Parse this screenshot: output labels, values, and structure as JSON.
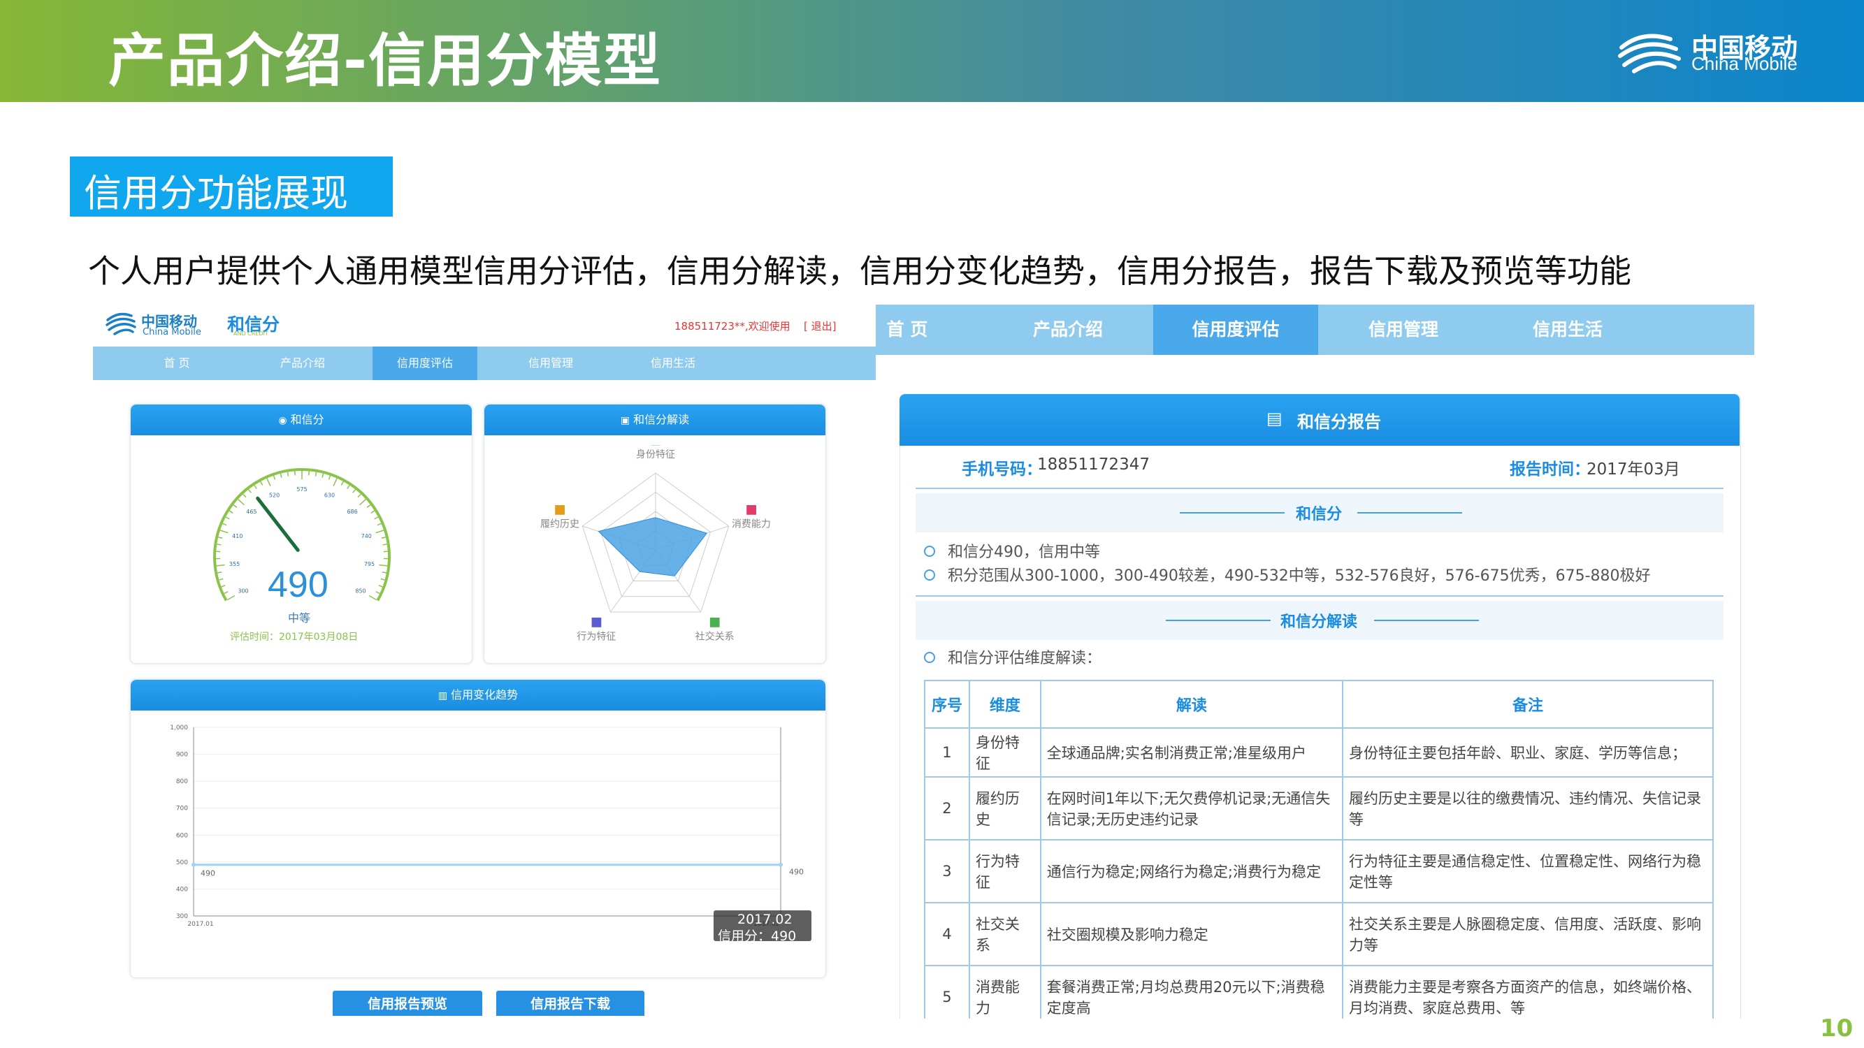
{
  "slide": {
    "title": "产品介绍-信用分模型",
    "brand_cn": "中国移动",
    "brand_en": "China Mobile",
    "section_title": "信用分功能展现",
    "description": "个人用户提供个人通用模型信用分评估，信用分解读，信用分变化趋势，信用分报告，报告下载及预览等功能",
    "page_number": "10"
  },
  "left_app": {
    "logo_cn": "中国移动",
    "logo_en": "China Mobile",
    "product_logo": "和信分",
    "product_logo_en": "AND CREDIT",
    "user_greeting": "188511723**,欢迎使用",
    "logout": "[ 退出]",
    "nav": [
      "首 页",
      "产品介绍",
      "信用度评估",
      "信用管理",
      "信用生活"
    ],
    "nav_active_index": 2,
    "score_panel": {
      "title": "和信分",
      "score": "490",
      "level": "中等",
      "eval_time": "评估时间：2017年03月08日",
      "gauge_ticks": [
        "300",
        "355",
        "410",
        "465",
        "520",
        "575",
        "630",
        "686",
        "740",
        "795",
        "850"
      ],
      "gauge_min": 300,
      "gauge_max": 850,
      "needle_value": 490
    },
    "radar_panel": {
      "title": "和信分解读",
      "axes": [
        "身份特征",
        "消费能力",
        "社交关系",
        "行为特征",
        "履约历史"
      ],
      "values": [
        0.42,
        0.7,
        0.42,
        0.35,
        0.78
      ]
    },
    "trend_panel": {
      "title": "信用变化趋势",
      "tooltip_date": "2017.02",
      "tooltip_value": "信用分：490"
    },
    "buttons": [
      "信用报告预览",
      "信用报告下载"
    ]
  },
  "chart_data": {
    "type": "line",
    "title": "信用变化趋势",
    "x": [
      "2017.01",
      "2017.02"
    ],
    "series": [
      {
        "values": [
          490,
          490
        ]
      }
    ],
    "yticks": [
      300,
      400,
      500,
      600,
      700,
      800,
      900,
      1000
    ],
    "ytick_labels": [
      "300",
      "400",
      "500",
      "600",
      "700",
      "800",
      "900",
      "1,000"
    ],
    "ylim": [
      300,
      1000
    ],
    "point_labels": [
      "490",
      "490"
    ],
    "grid": true
  },
  "right_app": {
    "nav": [
      "首 页",
      "产品介绍",
      "信用度评估",
      "信用管理",
      "信用生活"
    ],
    "nav_active_index": 2,
    "report_title": "和信分报告",
    "phone_label": "手机号码：",
    "phone_value": "18851172347",
    "time_label": "报告时间：",
    "time_value": "2017年03月",
    "score_section": "和信分",
    "score_lines": [
      "和信分490，信用中等",
      "积分范围从300-1000，300-490较差，490-532中等，532-576良好，576-675优秀，675-880极好"
    ],
    "reading_section": "和信分解读",
    "reading_intro": "和信分评估维度解读：",
    "table": {
      "headers": [
        "序号",
        "维度",
        "解读",
        "备注"
      ],
      "rows": [
        [
          "1",
          "身份特征",
          "全球通品牌;实名制消费正常;准星级用户",
          "身份特征主要包括年龄、职业、家庭、学历等信息；"
        ],
        [
          "2",
          "履约历史",
          "在网时间1年以下;无欠费停机记录;无通信失信记录;无历史违约记录",
          "履约历史主要是以往的缴费情况、违约情况、失信记录等"
        ],
        [
          "3",
          "行为特征",
          "通信行为稳定;网络行为稳定;消费行为稳定",
          "行为特征主要是通信稳定性、位置稳定性、网络行为稳定性等"
        ],
        [
          "4",
          "社交关系",
          "社交圈规模及影响力稳定",
          "社交关系主要是人脉圈稳定度、信用度、活跃度、影响力等"
        ],
        [
          "5",
          "消费能力",
          "套餐消费正常;月均总费用20元以下;消费稳定度高",
          "消费能力主要是考察各方面资产的信息，如终端价格、月均消费、家庭总费用、等"
        ]
      ]
    }
  },
  "colors": {
    "accent": "#1a8de2",
    "nav": "#8ecbef",
    "section": "#11a7ef",
    "page_number": "#8ac040"
  }
}
